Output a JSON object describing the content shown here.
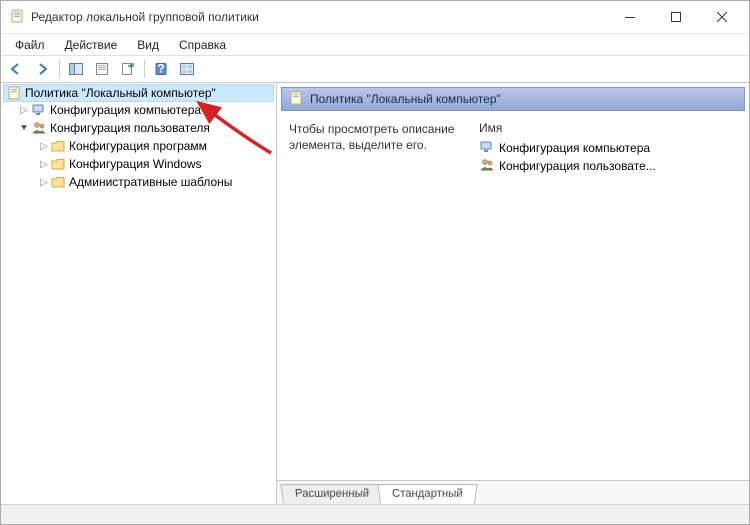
{
  "window": {
    "title": "Редактор локальной групповой политики"
  },
  "menu": {
    "file": "Файл",
    "action": "Действие",
    "view": "Вид",
    "help": "Справка"
  },
  "tree": {
    "root": "Политика \"Локальный компьютер\"",
    "computer_config": "Конфигурация компьютера",
    "user_config": "Конфигурация пользователя",
    "software_config": "Конфигурация программ",
    "windows_config": "Конфигурация Windows",
    "admin_templates": "Административные шаблоны"
  },
  "detail": {
    "header": "Политика \"Локальный компьютер\"",
    "description": "Чтобы просмотреть описание элемента, выделите его.",
    "column_name": "Имя",
    "items": {
      "computer": "Конфигурация компьютера",
      "user": "Конфигурация пользовате..."
    }
  },
  "tabs": {
    "extended": "Расширенный",
    "standard": "Стандартный"
  }
}
